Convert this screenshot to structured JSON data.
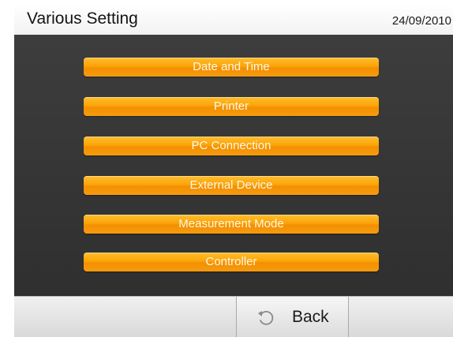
{
  "header": {
    "title": "Various Setting",
    "date": "24/09/2010"
  },
  "menu": {
    "items": [
      {
        "label": "Date and Time"
      },
      {
        "label": "Printer"
      },
      {
        "label": "PC Connection"
      },
      {
        "label": "External Device"
      },
      {
        "label": "Measurement Mode"
      },
      {
        "label": "Controller"
      }
    ]
  },
  "footer": {
    "back_label": "Back",
    "back_icon": "back-arrow-icon"
  },
  "colors": {
    "accent": "#f9a20c",
    "panel": "#363636"
  }
}
